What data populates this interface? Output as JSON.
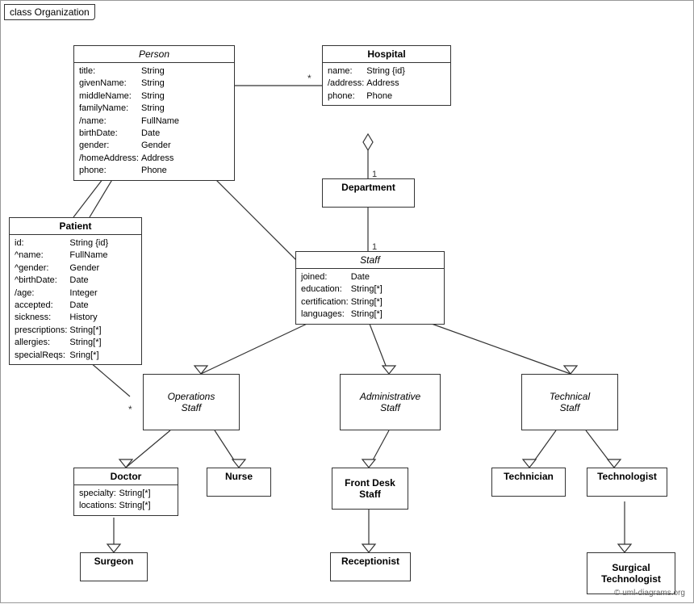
{
  "title": "class Organization",
  "classes": {
    "person": {
      "name": "Person",
      "italic": true,
      "attrs": [
        [
          "title:",
          "String"
        ],
        [
          "givenName:",
          "String"
        ],
        [
          "middleName:",
          "String"
        ],
        [
          "familyName:",
          "String"
        ],
        [
          "/name:",
          "FullName"
        ],
        [
          "birthDate:",
          "Date"
        ],
        [
          "gender:",
          "Gender"
        ],
        [
          "/homeAddress:",
          "Address"
        ],
        [
          "phone:",
          "Phone"
        ]
      ]
    },
    "hospital": {
      "name": "Hospital",
      "italic": false,
      "attrs": [
        [
          "name:",
          "String {id}"
        ],
        [
          "/address:",
          "Address"
        ],
        [
          "phone:",
          "Phone"
        ]
      ]
    },
    "patient": {
      "name": "Patient",
      "italic": false,
      "attrs": [
        [
          "id:",
          "String {id}"
        ],
        [
          "^name:",
          "FullName"
        ],
        [
          "^gender:",
          "Gender"
        ],
        [
          "^birthDate:",
          "Date"
        ],
        [
          "/age:",
          "Integer"
        ],
        [
          "accepted:",
          "Date"
        ],
        [
          "sickness:",
          "History"
        ],
        [
          "prescriptions:",
          "String[*]"
        ],
        [
          "allergies:",
          "String[*]"
        ],
        [
          "specialReqs:",
          "Sring[*]"
        ]
      ]
    },
    "department": {
      "name": "Department",
      "italic": false,
      "attrs": []
    },
    "staff": {
      "name": "Staff",
      "italic": true,
      "attrs": [
        [
          "joined:",
          "Date"
        ],
        [
          "education:",
          "String[*]"
        ],
        [
          "certification:",
          "String[*]"
        ],
        [
          "languages:",
          "String[*]"
        ]
      ]
    },
    "operationsStaff": {
      "name": "Operations\nStaff",
      "italic": true,
      "attrs": []
    },
    "administrativeStaff": {
      "name": "Administrative\nStaff",
      "italic": true,
      "attrs": []
    },
    "technicalStaff": {
      "name": "Technical\nStaff",
      "italic": true,
      "attrs": []
    },
    "doctor": {
      "name": "Doctor",
      "italic": false,
      "attrs": [
        [
          "specialty:",
          "String[*]"
        ],
        [
          "locations:",
          "String[*]"
        ]
      ]
    },
    "nurse": {
      "name": "Nurse",
      "italic": false,
      "attrs": []
    },
    "frontDeskStaff": {
      "name": "Front Desk\nStaff",
      "italic": false,
      "attrs": []
    },
    "technician": {
      "name": "Technician",
      "italic": false,
      "attrs": []
    },
    "technologist": {
      "name": "Technologist",
      "italic": false,
      "attrs": []
    },
    "surgeon": {
      "name": "Surgeon",
      "italic": false,
      "attrs": []
    },
    "receptionist": {
      "name": "Receptionist",
      "italic": false,
      "attrs": []
    },
    "surgicalTechnologist": {
      "name": "Surgical\nTechnologist",
      "italic": false,
      "attrs": []
    }
  },
  "copyright": "© uml-diagrams.org"
}
